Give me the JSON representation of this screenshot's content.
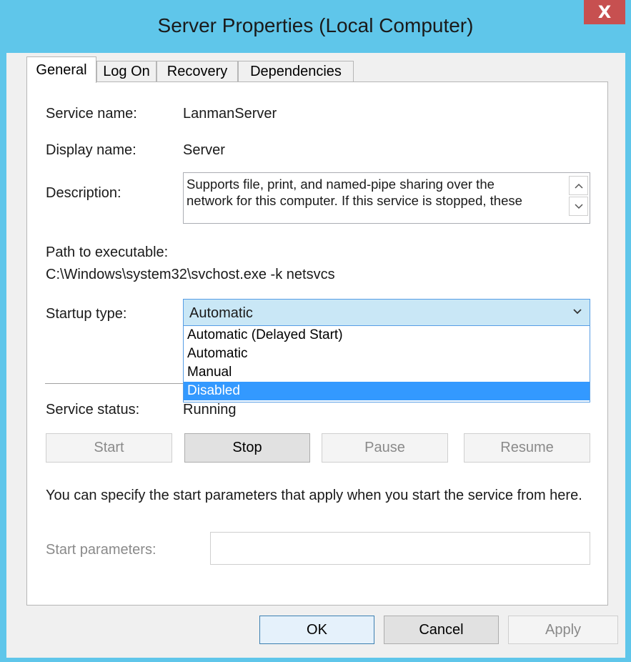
{
  "window": {
    "title": "Server Properties (Local Computer)",
    "close_label": "X"
  },
  "tabs": [
    {
      "label": "General"
    },
    {
      "label": "Log On"
    },
    {
      "label": "Recovery"
    },
    {
      "label": "Dependencies"
    }
  ],
  "general": {
    "service_name_label": "Service name:",
    "service_name_value": "LanmanServer",
    "display_name_label": "Display name:",
    "display_name_value": "Server",
    "description_label": "Description:",
    "description_line1": "Supports file, print, and named-pipe sharing over the",
    "description_line2": "network for this computer. If this service is stopped, these",
    "path_label": "Path to executable:",
    "path_value": "C:\\Windows\\system32\\svchost.exe -k netsvcs",
    "startup_label": "Startup type:",
    "startup_selected": "Automatic",
    "startup_options": [
      {
        "label": "Automatic (Delayed Start)"
      },
      {
        "label": "Automatic"
      },
      {
        "label": "Manual"
      },
      {
        "label": "Disabled"
      }
    ],
    "status_label": "Service status:",
    "status_value": "Running",
    "buttons": {
      "start": "Start",
      "stop": "Stop",
      "pause": "Pause",
      "resume": "Resume"
    },
    "params_info": "You can specify the start parameters that apply when you start the service from here.",
    "params_label": "Start parameters:"
  },
  "footer": {
    "ok": "OK",
    "cancel": "Cancel",
    "apply": "Apply"
  },
  "icons": {
    "scroll_up": "chevron-up-icon",
    "scroll_down": "chevron-down-icon",
    "combo_arrow": "chevron-down-icon"
  }
}
